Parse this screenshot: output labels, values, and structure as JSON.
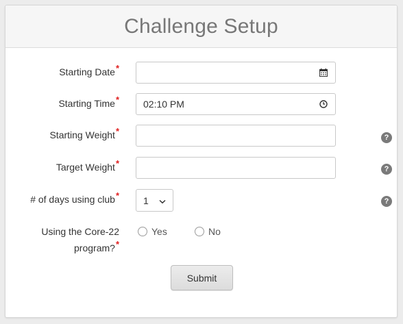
{
  "title": "Challenge Setup",
  "required_mark": "*",
  "fields": {
    "starting_date": {
      "label": "Starting Date",
      "value": "",
      "icon": "calendar-icon"
    },
    "starting_time": {
      "label": "Starting Time",
      "value": "02:10 PM",
      "icon": "clock-icon"
    },
    "starting_weight": {
      "label": "Starting Weight",
      "value": ""
    },
    "target_weight": {
      "label": "Target Weight",
      "value": ""
    },
    "days_using_club": {
      "label": "# of days using club",
      "value": "1"
    },
    "core22": {
      "label_line1": "Using the Core-22",
      "label_line2": "program?",
      "options": [
        "Yes",
        "No"
      ]
    }
  },
  "help_glyph": "?",
  "submit_label": "Submit"
}
